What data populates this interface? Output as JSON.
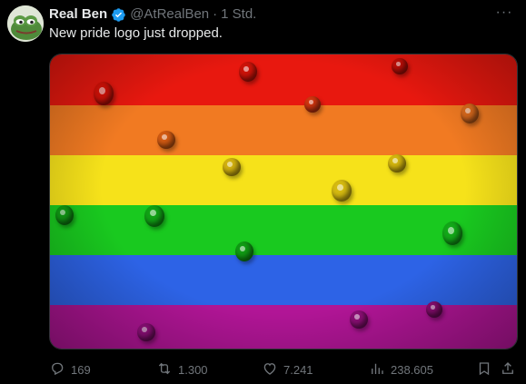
{
  "author": {
    "name": "Real Ben",
    "handle": "@AtRealBen",
    "separator": "·",
    "time": "1 Std.",
    "verified": true
  },
  "tweet": {
    "text": "New pride logo just dropped."
  },
  "more_label": "···",
  "media": {
    "description_icon": "rainbow-flag-image",
    "colors": [
      "#e8180f",
      "#f17a22",
      "#f6e21a",
      "#19c91f",
      "#2d63e6",
      "#b11596"
    ]
  },
  "actions": {
    "reply_count": "169",
    "repost_count": "1.300",
    "like_count": "7.241",
    "views_count": "238.605"
  },
  "colors": {
    "background": "#000000",
    "text": "#e7e9ea",
    "secondary": "#71767b",
    "verified": "#1d9bf0"
  }
}
